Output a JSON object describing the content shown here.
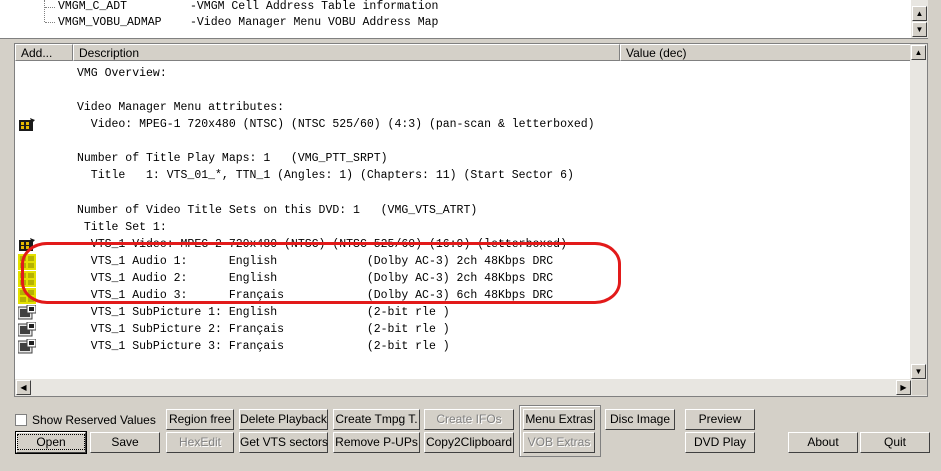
{
  "tree": {
    "items": [
      {
        "name": "VMGM_C_ADT",
        "desc": "-VMGM Cell Address Table information"
      },
      {
        "name": "VMGM_VOBU_ADMAP",
        "desc": "-Video Manager Menu VOBU Address Map"
      }
    ]
  },
  "columns": {
    "addr": "Add...",
    "desc": "Description",
    "value": "Value (dec)"
  },
  "lines": [
    {
      "text": "VMG Overview:",
      "icon": ""
    },
    {
      "text": "Video Manager Menu attributes:",
      "icon": ""
    },
    {
      "text": "  Video: MPEG-1 720x480 (NTSC) (NTSC 525/60) (4:3) (pan-scan & letterboxed)",
      "icon": "film-icon"
    },
    {
      "text": "Number of Title Play Maps: 1   (VMG_PTT_SRPT)",
      "icon": ""
    },
    {
      "text": "  Title   1: VTS_01_*, TTN_1 (Angles: 1) (Chapters: 11) (Start Sector 6)",
      "icon": ""
    },
    {
      "text": "Number of Video Title Sets on this DVD: 1   (VMG_VTS_ATRT)",
      "icon": ""
    },
    {
      "text": " Title Set 1:",
      "icon": ""
    },
    {
      "text": "  VTS_1 Video: MPEG-2 720x480 (NTSC) (NTSC 525/60) (16:9) (letterboxed)",
      "icon": "film-icon"
    },
    {
      "text": "  VTS_1 Audio 1:      English             (Dolby AC-3) 2ch 48Kbps DRC",
      "icon": "audio-icon"
    },
    {
      "text": "  VTS_1 Audio 2:      English             (Dolby AC-3) 2ch 48Kbps DRC",
      "icon": "audio-icon"
    },
    {
      "text": "  VTS_1 Audio 3:      Français            (Dolby AC-3) 6ch 48Kbps DRC",
      "icon": "audio-icon"
    },
    {
      "text": "  VTS_1 SubPicture 1: English             (2-bit rle )",
      "icon": "subpicture-icon"
    },
    {
      "text": "  VTS_1 SubPicture 2: Français            (2-bit rle )",
      "icon": "subpicture-icon"
    },
    {
      "text": "  VTS_1 SubPicture 3: Français            (2-bit rle )",
      "icon": "subpicture-icon"
    }
  ],
  "controls": {
    "show_reserved": "Show Reserved Values",
    "open": "Open",
    "save": "Save",
    "region_free": "Region free",
    "hexedit": "HexEdit",
    "delete_playback": "Delete Playback",
    "get_vts_sectors": "Get VTS sectors",
    "create_tmpg": "Create Tmpg T.",
    "remove_pups": "Remove P-UPs",
    "create_ifos": "Create IFOs",
    "copy2clipboard": "Copy2Clipboard",
    "menu_extras": "Menu Extras",
    "vob_extras": "VOB Extras",
    "disc_image": "Disc Image",
    "preview": "Preview",
    "dvd_play": "DVD Play",
    "about": "About",
    "quit": "Quit"
  },
  "colors": {
    "highlight": "#e21a1a",
    "window": "#d4d0c8"
  }
}
